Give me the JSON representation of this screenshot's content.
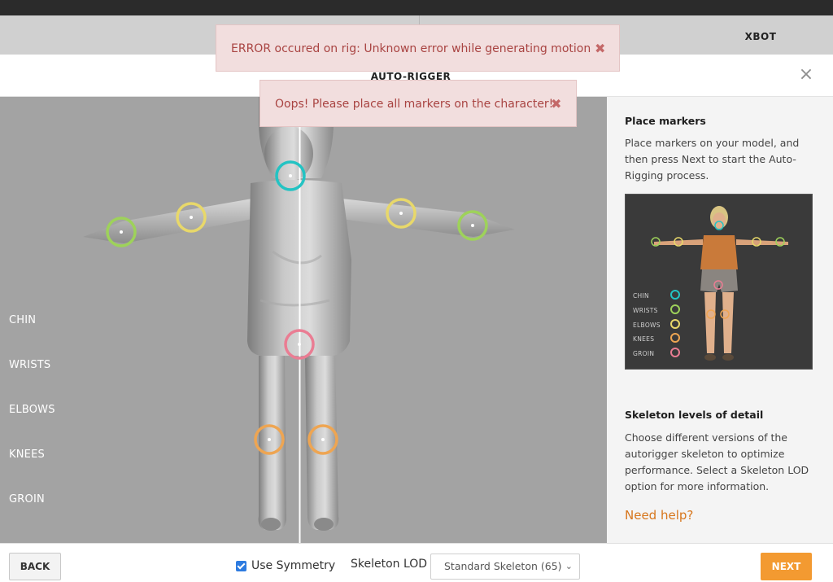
{
  "header": {
    "project_name": "XBOT"
  },
  "modal": {
    "title": "AUTO-RIGGER",
    "close_glyph": "×"
  },
  "toasts": [
    {
      "text": "ERROR occured on rig: Unknown error while generating motion",
      "close_glyph": "✖"
    },
    {
      "text": "Oops! Please place all markers on the character!",
      "close_glyph": "✖"
    }
  ],
  "markers": [
    {
      "label": "CHIN",
      "color": "#23c3c3"
    },
    {
      "label": "WRISTS",
      "color": "#9ed25a"
    },
    {
      "label": "ELBOWS",
      "color": "#e8d86a"
    },
    {
      "label": "KNEES",
      "color": "#eea552"
    },
    {
      "label": "GROIN",
      "color": "#ea7d93"
    }
  ],
  "side_panel": {
    "place_title": "Place markers",
    "place_text": "Place markers on your model, and then press Next to start the Auto-Rigging process.",
    "lod_title": "Skeleton levels of detail",
    "lod_text": "Choose different versions of the autorigger skeleton to optimize performance. Select a Skeleton LOD option for more information.",
    "help_link": "Need help?"
  },
  "footer": {
    "back_label": "BACK",
    "symmetry_label": "Use Symmetry",
    "symmetry_checked": true,
    "lod_label": "Skeleton LOD",
    "lod_selected": "Standard Skeleton (65)",
    "next_label": "NEXT"
  },
  "colors": {
    "accent": "#f39a31",
    "link": "#d7761c",
    "error_bg": "#f2dede",
    "error_text": "#a94442"
  }
}
